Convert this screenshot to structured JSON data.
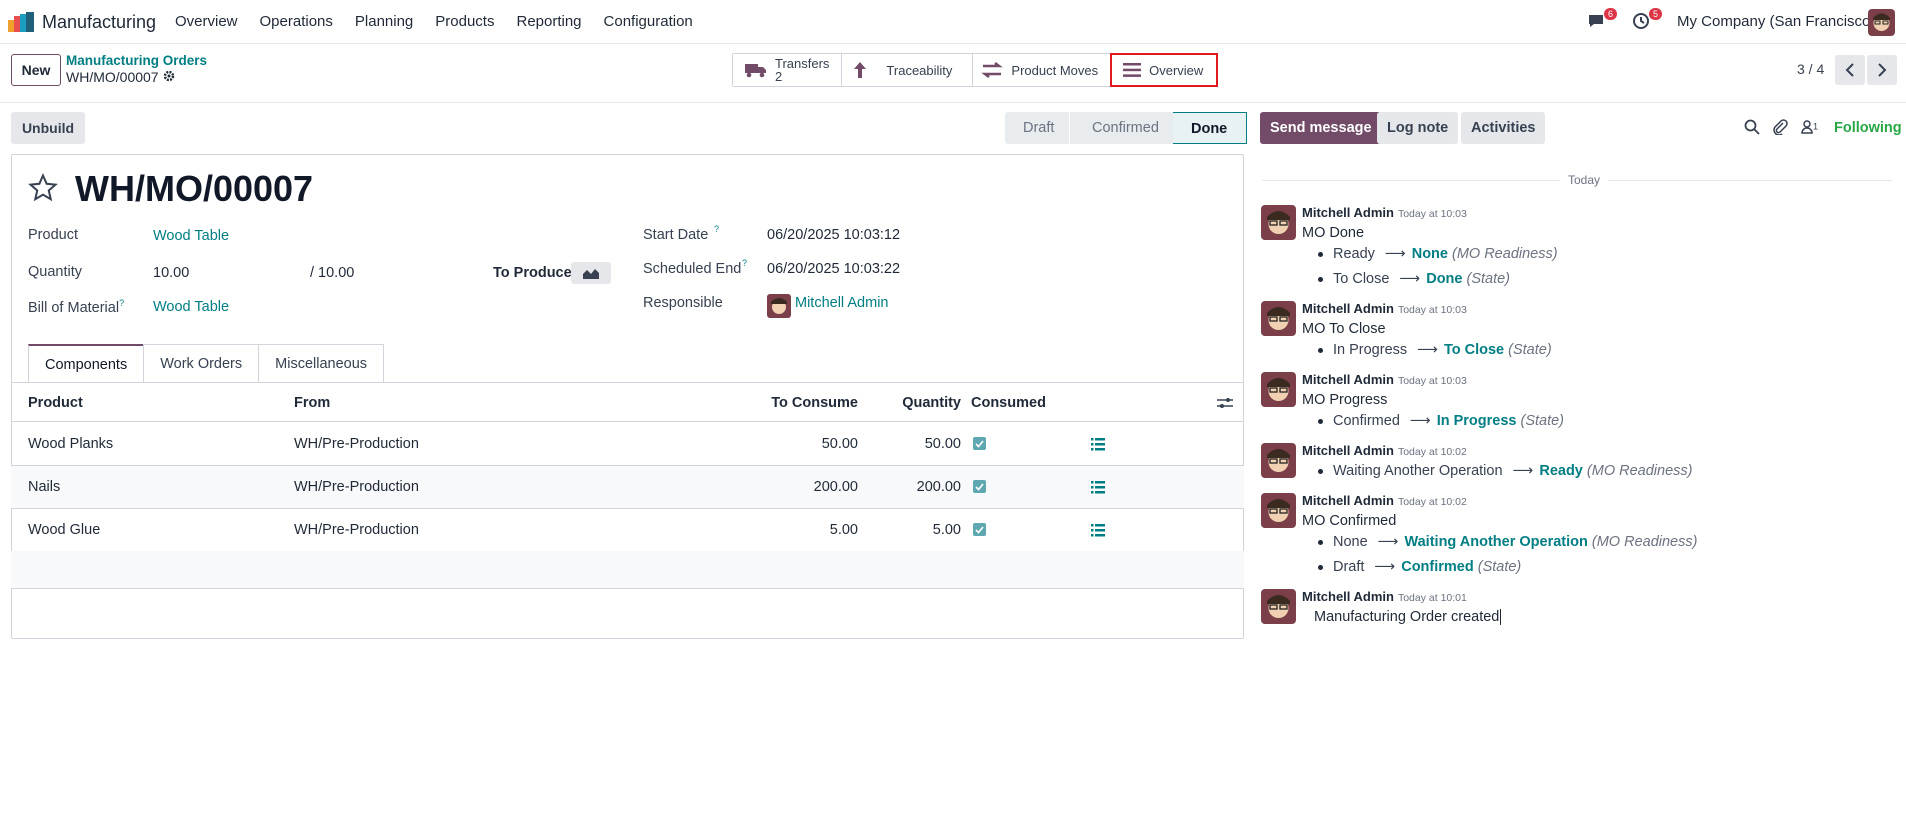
{
  "navbar": {
    "app_name": "Manufacturing",
    "menu": [
      "Overview",
      "Operations",
      "Planning",
      "Products",
      "Reporting",
      "Configuration"
    ],
    "messages_badge": "6",
    "activities_badge": "5",
    "company": "My Company (San Francisco)"
  },
  "control": {
    "new_label": "New",
    "breadcrumb_parent": "Manufacturing Orders",
    "breadcrumb_current": "WH/MO/00007",
    "smart_buttons": {
      "transfers_label": "Transfers",
      "transfers_count": "2",
      "traceability": "Traceability",
      "product_moves": "Product Moves",
      "overview": "Overview"
    },
    "pager": "3 / 4"
  },
  "statusbar": {
    "unbuild_label": "Unbuild",
    "stages": [
      "Draft",
      "Confirmed",
      "Done"
    ],
    "active_stage": "Done"
  },
  "form": {
    "title": "WH/MO/00007",
    "product_label": "Product",
    "product_value": "Wood Table",
    "quantity_label": "Quantity",
    "quantity_value": "10.00",
    "quantity_total": "/ 10.00",
    "to_produce_label": "To Produce",
    "bom_label": "Bill of Material",
    "bom_value": "Wood Table",
    "start_date_label": "Start Date",
    "start_date_value": "06/20/2025 10:03:12",
    "scheduled_end_label": "Scheduled End",
    "scheduled_end_value": "06/20/2025 10:03:22",
    "responsible_label": "Responsible",
    "responsible_value": "Mitchell Admin",
    "help_mark": "?"
  },
  "tabs": [
    "Components",
    "Work Orders",
    "Miscellaneous"
  ],
  "table": {
    "headers": [
      "Product",
      "From",
      "To Consume",
      "Quantity",
      "Consumed"
    ],
    "rows": [
      {
        "product": "Wood Planks",
        "from": "WH/Pre-Production",
        "to_consume": "50.00",
        "quantity": "50.00",
        "consumed": true
      },
      {
        "product": "Nails",
        "from": "WH/Pre-Production",
        "to_consume": "200.00",
        "quantity": "200.00",
        "consumed": true
      },
      {
        "product": "Wood Glue",
        "from": "WH/Pre-Production",
        "to_consume": "5.00",
        "quantity": "5.00",
        "consumed": true
      }
    ]
  },
  "chatter": {
    "send_message": "Send message",
    "log_note": "Log note",
    "activities": "Activities",
    "followers_count": "1",
    "following": "Following",
    "today": "Today",
    "messages": [
      {
        "author": "Mitchell Admin",
        "time": "Today at 10:03",
        "body": "MO Done",
        "tracking": [
          {
            "old": "Ready",
            "new": "None",
            "field": "(MO Readiness)"
          },
          {
            "old": "To Close",
            "new": "Done",
            "field": "(State)"
          }
        ]
      },
      {
        "author": "Mitchell Admin",
        "time": "Today at 10:03",
        "body": "MO To Close",
        "tracking": [
          {
            "old": "In Progress",
            "new": "To Close",
            "field": "(State)"
          }
        ]
      },
      {
        "author": "Mitchell Admin",
        "time": "Today at 10:03",
        "body": "MO Progress",
        "tracking": [
          {
            "old": "Confirmed",
            "new": "In Progress",
            "field": "(State)"
          }
        ]
      },
      {
        "author": "Mitchell Admin",
        "time": "Today at 10:02",
        "body": "",
        "tracking": [
          {
            "old": "Waiting Another Operation",
            "new": "Ready",
            "field": "(MO Readiness)"
          }
        ]
      },
      {
        "author": "Mitchell Admin",
        "time": "Today at 10:02",
        "body": "MO Confirmed",
        "tracking": [
          {
            "old": "None",
            "new": "Waiting Another Operation",
            "field": "(MO Readiness)"
          },
          {
            "old": "Draft",
            "new": "Confirmed",
            "field": "(State)"
          }
        ]
      },
      {
        "author": "Mitchell Admin",
        "time": "Today at 10:01",
        "body": "Manufacturing Order created",
        "tracking": []
      }
    ]
  },
  "colors": {
    "brand": "#714b67",
    "link": "#017e84",
    "following": "#28a745",
    "badge": "#dc3545",
    "highlight": "#e0191f"
  }
}
